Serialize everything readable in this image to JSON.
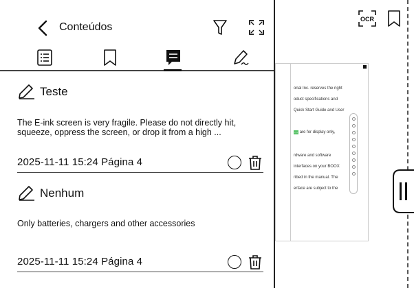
{
  "header": {
    "title": "Conteúdos",
    "back_icon": "chevron-left-icon",
    "filter_icon": "filter-icon",
    "expand_icon": "expand-icon"
  },
  "tabs": [
    {
      "icon": "list-icon",
      "active": false
    },
    {
      "icon": "bookmark-icon",
      "active": false
    },
    {
      "icon": "note-icon",
      "active": true
    },
    {
      "icon": "pen-icon",
      "active": false
    }
  ],
  "entries": [
    {
      "title": "Teste",
      "text": "The E-ink screen is very fragile. Please do not directly hit, squeeze, oppress the screen, or drop it from a high ...",
      "meta": "2025-11-11 15:24  Página 4"
    },
    {
      "title": "Nenhum",
      "text": "Only batteries, chargers and other accessories",
      "meta": "2025-11-11 15:24  Página 4"
    }
  ],
  "reader": {
    "ocr_label": "OCR",
    "thumb_lines": [
      "onal Inc. reserves the right",
      "oduct specifications and",
      "Quick Start Guide and User",
      "are for display only,",
      "rdware and software",
      "interfaces on your BOOX",
      "ribed in the manual. The",
      "erface are subject to the"
    ],
    "highlight_text": "..."
  },
  "colors": {
    "accent_highlight": "#5cc46b",
    "text": "#111111",
    "divider": "#444444"
  }
}
